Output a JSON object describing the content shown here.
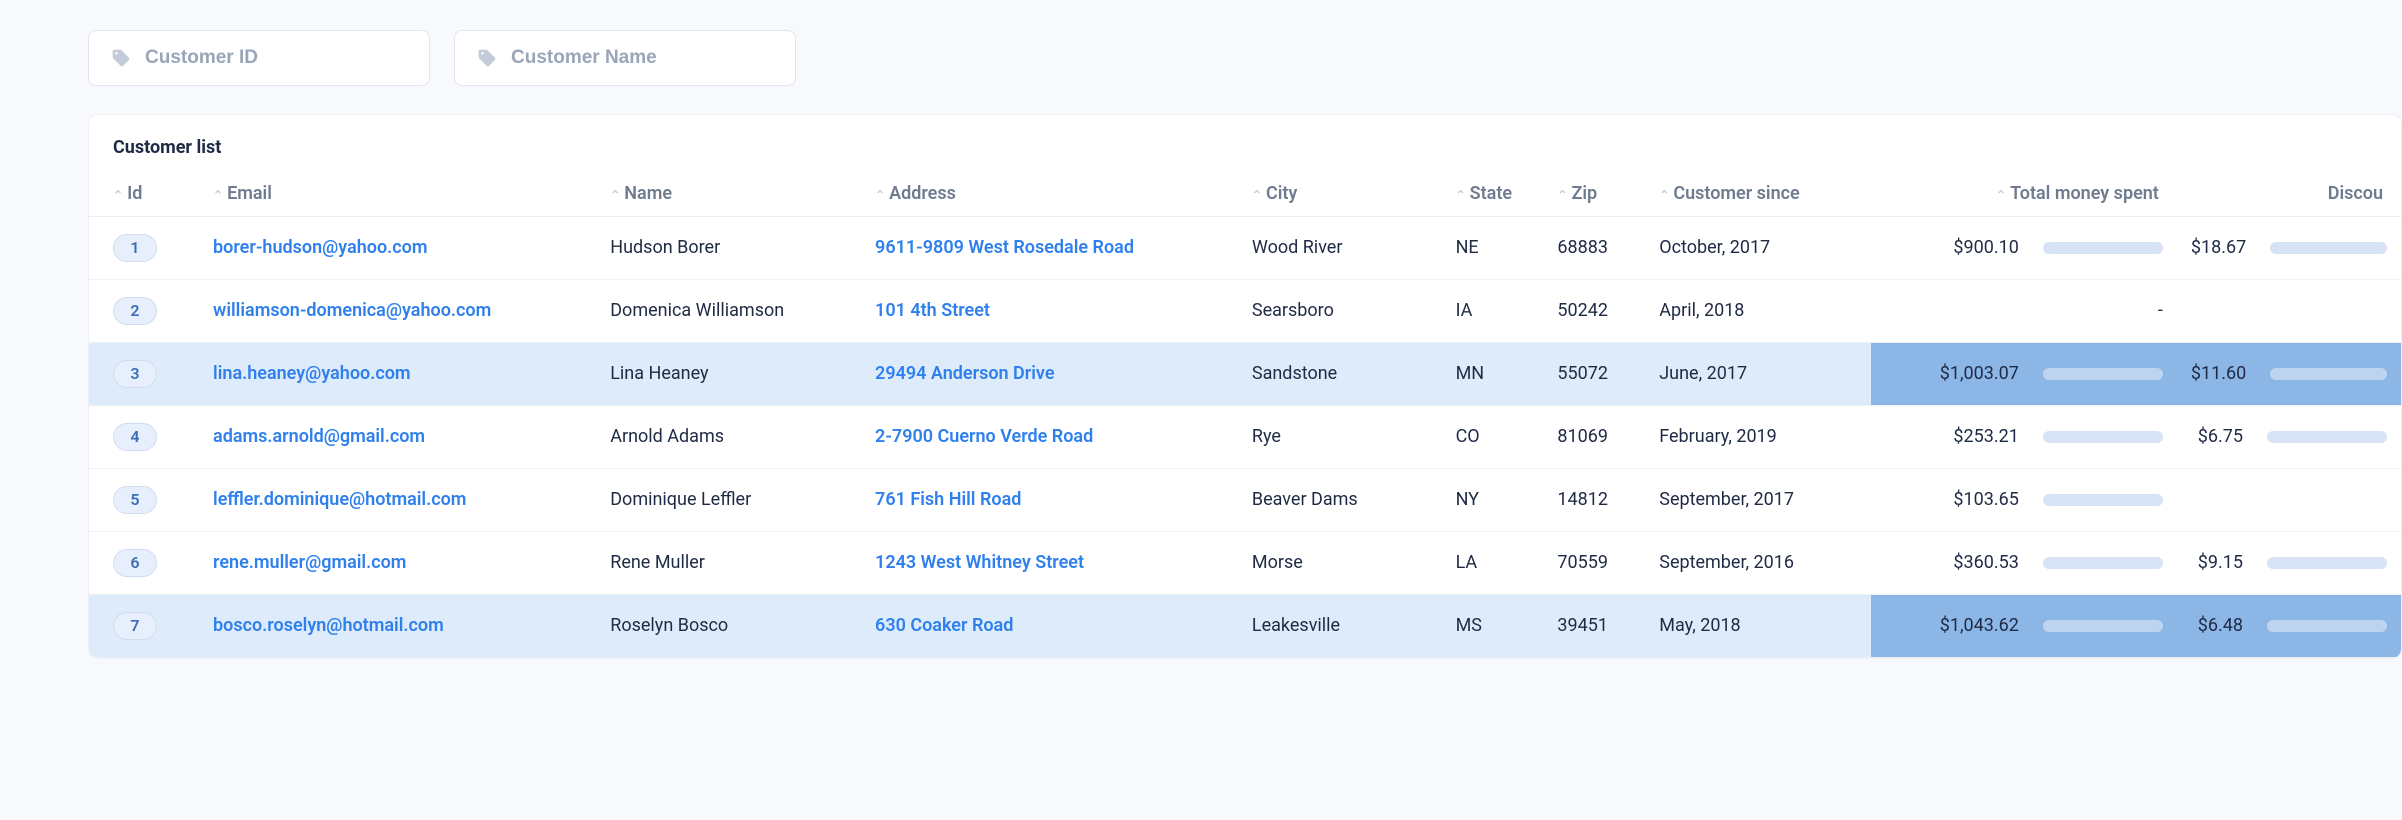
{
  "filters": {
    "id_placeholder": "Customer ID",
    "name_placeholder": "Customer Name"
  },
  "card_title": "Customer list",
  "columns": {
    "id": "Id",
    "email": "Email",
    "name": "Name",
    "address": "Address",
    "city": "City",
    "state": "State",
    "zip": "Zip",
    "since": "Customer since",
    "total": "Total money spent",
    "discount": "Discou"
  },
  "max_total": 1100,
  "max_discount": 20,
  "rows": [
    {
      "id": "1",
      "email": "borer-hudson@yahoo.com",
      "name": "Hudson Borer",
      "address": "9611-9809 West Rosedale Road",
      "city": "Wood River",
      "state": "NE",
      "zip": "68883",
      "since": "October, 2017",
      "total": "$900.10",
      "total_v": 900.1,
      "discount": "$18.67",
      "discount_v": 18.67,
      "hl": false
    },
    {
      "id": "2",
      "email": "williamson-domenica@yahoo.com",
      "name": "Domenica Williamson",
      "address": "101 4th Street",
      "city": "Searsboro",
      "state": "IA",
      "zip": "50242",
      "since": "April, 2018",
      "total": "-",
      "total_v": null,
      "discount": "",
      "discount_v": null,
      "hl": false
    },
    {
      "id": "3",
      "email": "lina.heaney@yahoo.com",
      "name": "Lina Heaney",
      "address": "29494 Anderson Drive",
      "city": "Sandstone",
      "state": "MN",
      "zip": "55072",
      "since": "June, 2017",
      "total": "$1,003.07",
      "total_v": 1003.07,
      "discount": "$11.60",
      "discount_v": 11.6,
      "hl": true
    },
    {
      "id": "4",
      "email": "adams.arnold@gmail.com",
      "name": "Arnold Adams",
      "address": "2-7900 Cuerno Verde Road",
      "city": "Rye",
      "state": "CO",
      "zip": "81069",
      "since": "February, 2019",
      "total": "$253.21",
      "total_v": 253.21,
      "discount": "$6.75",
      "discount_v": 6.75,
      "hl": false
    },
    {
      "id": "5",
      "email": "leffler.dominique@hotmail.com",
      "name": "Dominique Leffler",
      "address": "761 Fish Hill Road",
      "city": "Beaver Dams",
      "state": "NY",
      "zip": "14812",
      "since": "September, 2017",
      "total": "$103.65",
      "total_v": 103.65,
      "discount": "",
      "discount_v": null,
      "hl": false
    },
    {
      "id": "6",
      "email": "rene.muller@gmail.com",
      "name": "Rene Muller",
      "address": "1243 West Whitney Street",
      "city": "Morse",
      "state": "LA",
      "zip": "70559",
      "since": "September, 2016",
      "total": "$360.53",
      "total_v": 360.53,
      "discount": "$9.15",
      "discount_v": 9.15,
      "hl": false
    },
    {
      "id": "7",
      "email": "bosco.roselyn@hotmail.com",
      "name": "Roselyn Bosco",
      "address": "630 Coaker Road",
      "city": "Leakesville",
      "state": "MS",
      "zip": "39451",
      "since": "May, 2018",
      "total": "$1,043.62",
      "total_v": 1043.62,
      "discount": "$6.48",
      "discount_v": 6.48,
      "hl": true
    }
  ]
}
